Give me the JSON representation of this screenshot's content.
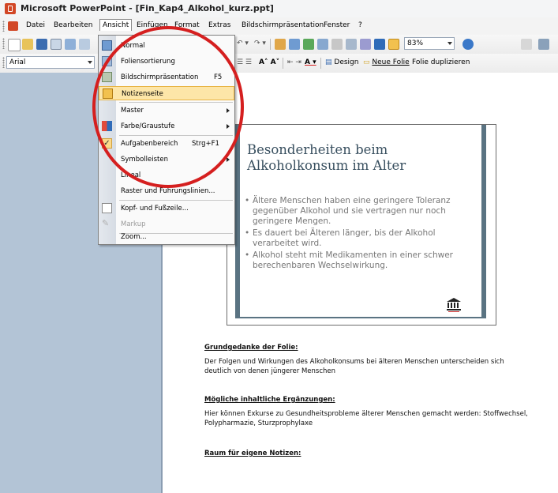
{
  "titlebar": {
    "title": "Microsoft PowerPoint - [Fin_Kap4_Alkohol_kurz.ppt]"
  },
  "menubar": {
    "items": [
      "Datei",
      "Bearbeiten",
      "Ansicht",
      "Einfügen",
      "Format",
      "Extras",
      "Bildschirmpräsentation",
      "Fenster",
      "?"
    ]
  },
  "toolbar": {
    "zoom": "83%"
  },
  "formatting": {
    "font": "Arial",
    "design_label": "Design",
    "new_slide_label": "Neue Folie",
    "duplicate_label": "Folie duplizieren"
  },
  "view_menu": {
    "items": [
      {
        "label": "Normal",
        "shortcut": ""
      },
      {
        "label": "Foliensortierung",
        "shortcut": ""
      },
      {
        "label": "Bildschirmpräsentation",
        "shortcut": "F5"
      },
      {
        "label": "Notizenseite",
        "shortcut": ""
      },
      {
        "label": "Master",
        "shortcut": ""
      },
      {
        "label": "Farbe/Graustufe",
        "shortcut": ""
      },
      {
        "label": "Aufgabenbereich",
        "shortcut": "Strg+F1"
      },
      {
        "label": "Symbolleisten",
        "shortcut": ""
      },
      {
        "label": "Lineal",
        "shortcut": ""
      },
      {
        "label": "Raster und Führungslinien...",
        "shortcut": ""
      },
      {
        "label": "Kopf- und Fußzeile...",
        "shortcut": ""
      },
      {
        "label": "Markup",
        "shortcut": ""
      },
      {
        "label": "Zoom...",
        "shortcut": ""
      }
    ],
    "highlighted": "Notizenseite"
  },
  "slide": {
    "title": "Besonderheiten beim Alkoholkonsum im Alter",
    "bullets": [
      "Ältere Menschen haben eine geringere Toleranz gegenüber Alkohol und sie vertragen nur noch geringere Mengen.",
      "Es dauert bei Älteren länger, bis der Alkohol verarbeitet wird.",
      "Alkohol steht mit Medikamenten in einer schwer berechenbaren Wechselwirkung."
    ]
  },
  "notes": {
    "heading1": "Grundgedanke der Folie:",
    "text1": "Der Folgen und Wirkungen des Alkoholkonsums bei älteren Menschen unterscheiden sich deutlich von denen jüngerer Menschen",
    "heading2": "Mögliche inhaltliche Ergänzungen:",
    "text2": "Hier können Exkurse zu Gesundheitsprobleme älterer Menschen gemacht werden: Stoffwechsel, Polypharmazie, Sturzprophylaxe",
    "heading3": "Raum für eigene Notizen:"
  },
  "colors": {
    "accent_red": "#d51f1f",
    "highlight": "#fde6a8",
    "slide_bar": "#5a7382",
    "pane": "#b3c4d6"
  }
}
